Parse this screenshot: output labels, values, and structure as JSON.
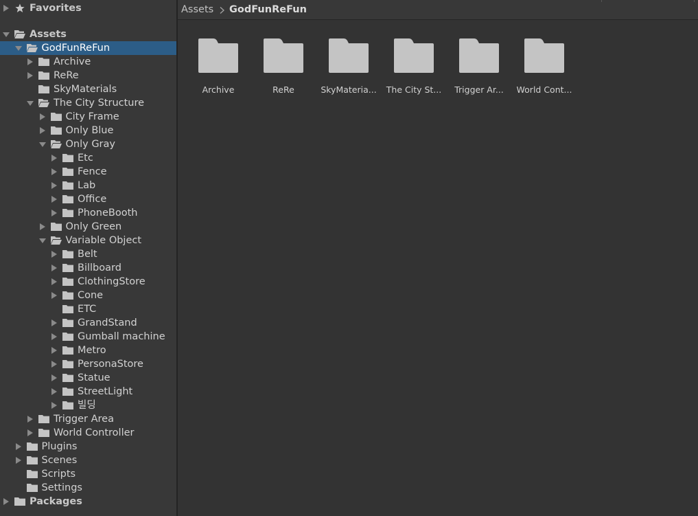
{
  "colors": {
    "panel_bg": "#383838",
    "content_bg": "#333333",
    "selection": "#2c5d87",
    "folder_icon": "#c4c4c4",
    "text": "#d2d2d2"
  },
  "tree": {
    "favorites_label": "Favorites",
    "assets_label": "Assets",
    "packages_label": "Packages",
    "rows": [
      {
        "label": "GodFunReFun",
        "depth": 1,
        "arrow": "down",
        "icon": "folder-open",
        "selected": true
      },
      {
        "label": "Archive",
        "depth": 2,
        "arrow": "right",
        "icon": "folder"
      },
      {
        "label": "ReRe",
        "depth": 2,
        "arrow": "right",
        "icon": "folder"
      },
      {
        "label": "SkyMaterials",
        "depth": 2,
        "arrow": "none",
        "icon": "folder"
      },
      {
        "label": "The City Structure",
        "depth": 2,
        "arrow": "down",
        "icon": "folder-open"
      },
      {
        "label": "City Frame",
        "depth": 3,
        "arrow": "right",
        "icon": "folder"
      },
      {
        "label": "Only Blue",
        "depth": 3,
        "arrow": "right",
        "icon": "folder"
      },
      {
        "label": "Only Gray",
        "depth": 3,
        "arrow": "down",
        "icon": "folder-open"
      },
      {
        "label": "Etc",
        "depth": 4,
        "arrow": "right",
        "icon": "folder"
      },
      {
        "label": "Fence",
        "depth": 4,
        "arrow": "right",
        "icon": "folder"
      },
      {
        "label": "Lab",
        "depth": 4,
        "arrow": "right",
        "icon": "folder"
      },
      {
        "label": "Office",
        "depth": 4,
        "arrow": "right",
        "icon": "folder"
      },
      {
        "label": "PhoneBooth",
        "depth": 4,
        "arrow": "right",
        "icon": "folder"
      },
      {
        "label": "Only Green",
        "depth": 3,
        "arrow": "right",
        "icon": "folder"
      },
      {
        "label": "Variable Object",
        "depth": 3,
        "arrow": "down",
        "icon": "folder-open"
      },
      {
        "label": "Belt",
        "depth": 4,
        "arrow": "right",
        "icon": "folder"
      },
      {
        "label": "Billboard",
        "depth": 4,
        "arrow": "right",
        "icon": "folder"
      },
      {
        "label": "ClothingStore",
        "depth": 4,
        "arrow": "right",
        "icon": "folder"
      },
      {
        "label": "Cone",
        "depth": 4,
        "arrow": "right",
        "icon": "folder"
      },
      {
        "label": "ETC",
        "depth": 4,
        "arrow": "none",
        "icon": "folder"
      },
      {
        "label": "GrandStand",
        "depth": 4,
        "arrow": "right",
        "icon": "folder"
      },
      {
        "label": "Gumball machine",
        "depth": 4,
        "arrow": "right",
        "icon": "folder"
      },
      {
        "label": "Metro",
        "depth": 4,
        "arrow": "right",
        "icon": "folder"
      },
      {
        "label": "PersonaStore",
        "depth": 4,
        "arrow": "right",
        "icon": "folder"
      },
      {
        "label": "Statue",
        "depth": 4,
        "arrow": "right",
        "icon": "folder"
      },
      {
        "label": "StreetLight",
        "depth": 4,
        "arrow": "right",
        "icon": "folder"
      },
      {
        "label": "빌딩",
        "depth": 4,
        "arrow": "right",
        "icon": "folder"
      },
      {
        "label": "Trigger Area",
        "depth": 2,
        "arrow": "right",
        "icon": "folder"
      },
      {
        "label": "World Controller",
        "depth": 2,
        "arrow": "right",
        "icon": "folder"
      },
      {
        "label": "Plugins",
        "depth": 1,
        "arrow": "right",
        "icon": "folder"
      },
      {
        "label": "Scenes",
        "depth": 1,
        "arrow": "right",
        "icon": "folder"
      },
      {
        "label": "Scripts",
        "depth": 1,
        "arrow": "none",
        "icon": "folder"
      },
      {
        "label": "Settings",
        "depth": 1,
        "arrow": "none",
        "icon": "folder"
      }
    ]
  },
  "breadcrumb": {
    "root": "Assets",
    "current": "GodFunReFun"
  },
  "grid": {
    "items": [
      {
        "label": "Archive"
      },
      {
        "label": "ReRe"
      },
      {
        "label": "SkyMateria..."
      },
      {
        "label": "The City St..."
      },
      {
        "label": "Trigger Ar..."
      },
      {
        "label": "World Cont..."
      }
    ]
  }
}
